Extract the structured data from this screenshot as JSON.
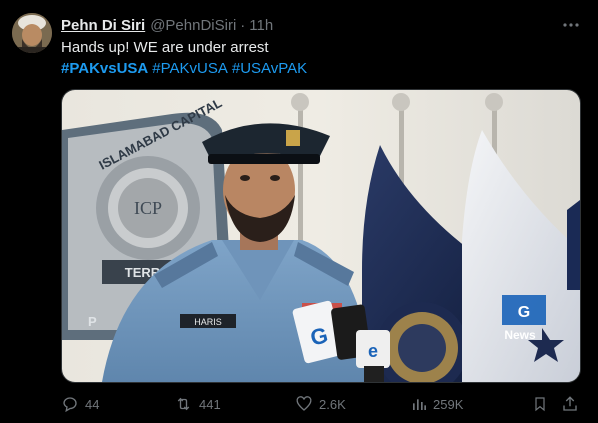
{
  "tweet": {
    "display_name": "Pehn Di Siri",
    "handle": "@PehnDiSiri",
    "separator": "·",
    "time": "11h",
    "text": "Hands up!  WE are under arrest",
    "hashtags": [
      "#PAKvsUSA",
      "#PAKvUSA",
      "#USAvPAK"
    ]
  },
  "media": {
    "sign_text_top": "ISLAMABAD CAPITAL",
    "sign_text_territory": "TERRITORY",
    "sign_monogram": "ICP",
    "sign_letters_bottom": "P",
    "name_plate": "HARIS",
    "watermark_brand": "News"
  },
  "actions": {
    "replies": "44",
    "reposts": "441",
    "likes": "2.6K",
    "views": "259K"
  },
  "colors": {
    "accent": "#1d9bf0",
    "muted": "#71767b",
    "text": "#e7e9ea",
    "background": "#000000"
  },
  "icons": [
    "more-icon",
    "reply-icon",
    "repost-icon",
    "like-icon",
    "views-icon",
    "bookmark-icon",
    "share-icon"
  ]
}
